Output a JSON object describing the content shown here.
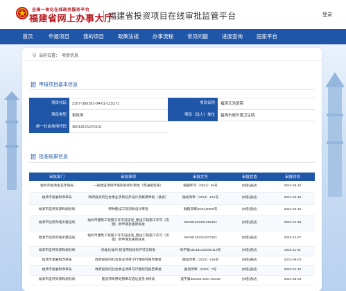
{
  "header": {
    "logo_line1": "全国一体化在线政务服务平台",
    "logo_line2": "福建省网上办事大厅",
    "site_title": "福建省投资项目在线审批监管平台",
    "login": "登录"
  },
  "nav": {
    "items": [
      "首页",
      "申报项目",
      "我的项目",
      "政策法规",
      "办事流程",
      "常见问题",
      "进度查询",
      "国家平台"
    ]
  },
  "breadcrumb": {
    "label": "当前位置：",
    "current": "项目信息"
  },
  "project_info": {
    "section_title": "申报项目基本信息",
    "rows": [
      {
        "label1": "项目代码",
        "value1": "2107-350181-04-01-115171",
        "label2": "项目名称",
        "value2": "福清元洪医院"
      },
      {
        "label1": "项目类型",
        "value1": "审批类",
        "label2": "项目（法人）单位",
        "value2": "福清市城头镇卫生院"
      },
      {
        "label1": "统一社会信用代码",
        "value1": "35018121070101",
        "label2": "",
        "value2": ""
      }
    ]
  },
  "approval": {
    "section_title": "批准结果信息",
    "columns": [
      "审批部门",
      "审批事项",
      "审批文号",
      "审批状态",
      "审批时间"
    ],
    "rows": [
      [
        "福州市福清生态环境局",
        "一般建设项目环境影响评价审批（普通报告表）",
        "榕融环评（2024）35号",
        "办结(通过)",
        "2024-05-10"
      ],
      [
        "福清市发展和改革局",
        "政府投资的社会事业项目初步设计及概算审批（县级）",
        "融发改审（2024）191号",
        "办结(通过)",
        "2024-04-26"
      ],
      [
        "福清市自然资源和规划局",
        "特种建设工程消防设计审查",
        "融建消审(2024)0060号",
        "办结(通过)",
        "2024-04-16"
      ],
      [
        "福清市住房和城乡建设局",
        "福州市建筑工程施工许可证核发_建设工程施工许可（房建）新申请及重新核发",
        "350181202401290101",
        "办结(通过)",
        "2024-01-29"
      ],
      [
        "福清市住房和城乡建设局",
        "福州市建筑工程施工许可证核发_建设工程施工许可（房建）新申请及重新核发",
        "350181202312070101",
        "办结(通过)",
        "2023-12-07"
      ],
      [
        "福清市自然资源和规划局",
        "标准化福州-建设用地规划许可证核发",
        "地字第350181202300113号",
        "办结(通过)",
        "2023-11-21"
      ],
      [
        "福清市发展和改革局",
        "政府投资的社会事业项目可行性研究报告审批",
        "融发改审（2023）515号",
        "办结(通过)",
        "2023-09-04"
      ],
      [
        "福清市发展和改革局",
        "政府投资的社会事业项目可行性研究报告审批",
        "融发改审（2022）7号",
        "办结(通过)",
        "2022-01-10"
      ],
      [
        "福清市自然资源和规划局",
        "建设项目用地预审与选址意见书核发",
        "选字第350181-2021-00192",
        "办结(通过)",
        "2021-08-06"
      ]
    ]
  },
  "colors": {
    "primary_blue": "#1f56a8",
    "logo_red": "#b8141c"
  }
}
